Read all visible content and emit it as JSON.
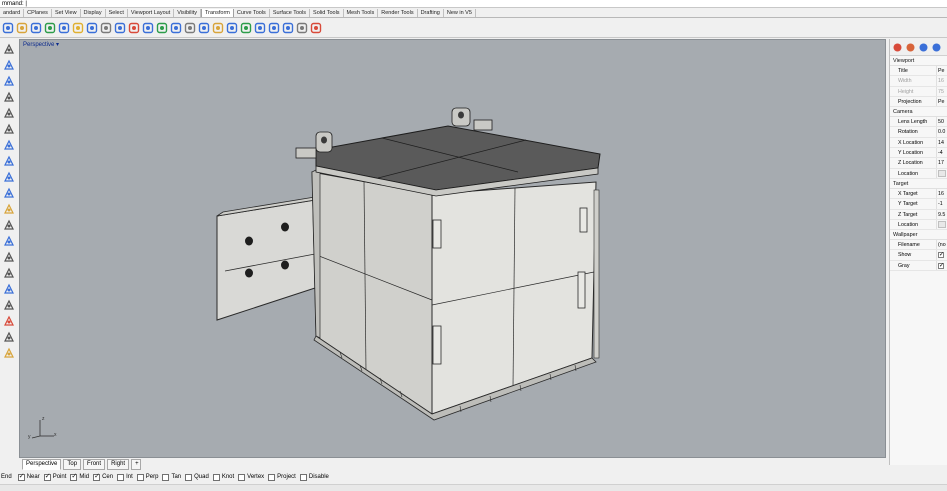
{
  "command_line": {
    "text": "mmand: |"
  },
  "toolbar_tabs": [
    {
      "label": "andard",
      "active": false
    },
    {
      "label": "CPlanes",
      "active": false
    },
    {
      "label": "Set View",
      "active": false
    },
    {
      "label": "Display",
      "active": false
    },
    {
      "label": "Select",
      "active": false
    },
    {
      "label": "Viewport Layout",
      "active": false
    },
    {
      "label": "Visibility",
      "active": false
    },
    {
      "label": "Transform",
      "active": true
    },
    {
      "label": "Curve Tools",
      "active": false
    },
    {
      "label": "Surface Tools",
      "active": false
    },
    {
      "label": "Solid Tools",
      "active": false
    },
    {
      "label": "Mesh Tools",
      "active": false
    },
    {
      "label": "Render Tools",
      "active": false
    },
    {
      "label": "Drafting",
      "active": false
    },
    {
      "label": "New in V5",
      "active": false
    }
  ],
  "toolbar_icons": [
    {
      "name": "move-icon",
      "color": "#3a6fd8"
    },
    {
      "name": "copy-icon",
      "color": "#d8a43a"
    },
    {
      "name": "rotate-icon",
      "color": "#3a6fd8"
    },
    {
      "name": "scale-icon",
      "color": "#2c9c4a"
    },
    {
      "name": "mirror-icon",
      "color": "#3a6fd8"
    },
    {
      "name": "orient-icon",
      "color": "#e0b030"
    },
    {
      "name": "array-icon",
      "color": "#3a6fd8"
    },
    {
      "name": "array-polar-icon",
      "color": "#7a7a7a"
    },
    {
      "name": "bend-icon",
      "color": "#3a6fd8"
    },
    {
      "name": "twist-icon",
      "color": "#d84a3a"
    },
    {
      "name": "taper-icon",
      "color": "#3a6fd8"
    },
    {
      "name": "flow-icon",
      "color": "#2c9c4a"
    },
    {
      "name": "smash-icon",
      "color": "#3a6fd8"
    },
    {
      "name": "cage-edit-icon",
      "color": "#7a7a7a"
    },
    {
      "name": "align-icon",
      "color": "#3a6fd8"
    },
    {
      "name": "set-points-icon",
      "color": "#d8a43a"
    },
    {
      "name": "project-icon",
      "color": "#3a6fd8"
    },
    {
      "name": "splop-icon",
      "color": "#2c9c4a"
    },
    {
      "name": "stretch-icon",
      "color": "#3a6fd8"
    },
    {
      "name": "shear-icon",
      "color": "#3a6fd8"
    },
    {
      "name": "maelstrom-icon",
      "color": "#3a6fd8"
    },
    {
      "name": "soft-move-icon",
      "color": "#7a7a7a"
    },
    {
      "name": "gumball-icon",
      "color": "#d84a3a"
    }
  ],
  "sidebar_icons": [
    {
      "name": "select-icon",
      "color": "#555"
    },
    {
      "name": "point-icon",
      "color": "#3a6fd8"
    },
    {
      "name": "polyline-icon",
      "color": "#3a6fd8"
    },
    {
      "name": "circle-icon",
      "color": "#555"
    },
    {
      "name": "rectangle-icon",
      "color": "#555"
    },
    {
      "name": "curve-icon",
      "color": "#555"
    },
    {
      "name": "fillet-icon",
      "color": "#3a6fd8"
    },
    {
      "name": "surface-icon",
      "color": "#3a6fd8"
    },
    {
      "name": "solid-icon",
      "color": "#3a6fd8"
    },
    {
      "name": "mesh-icon",
      "color": "#3a6fd8"
    },
    {
      "name": "dimension-icon",
      "color": "#d8a43a"
    },
    {
      "name": "transform-icon",
      "color": "#555"
    },
    {
      "name": "array-tool-icon",
      "color": "#3a6fd8"
    },
    {
      "name": "boolean-icon",
      "color": "#555"
    },
    {
      "name": "analyze-icon",
      "color": "#555"
    },
    {
      "name": "render-icon",
      "color": "#3a6fd8"
    },
    {
      "name": "gear-icon",
      "color": "#555"
    },
    {
      "name": "layer-icon",
      "color": "#d84a3a"
    },
    {
      "name": "check-icon",
      "color": "#555"
    },
    {
      "name": "paint-icon",
      "color": "#d8a43a"
    }
  ],
  "viewport": {
    "title": "Perspective",
    "dropdown_glyph": "▾",
    "background": "#a6abb0",
    "axis_x": "x",
    "axis_y": "y",
    "axis_z": "z"
  },
  "viewport_tabs": [
    {
      "label": "Perspective",
      "active": true
    },
    {
      "label": "Top",
      "active": false
    },
    {
      "label": "Front",
      "active": false
    },
    {
      "label": "Right",
      "active": false
    }
  ],
  "viewport_tab_add": "+",
  "osnaps": [
    {
      "label": "End",
      "checked": true
    },
    {
      "label": "Near",
      "checked": true
    },
    {
      "label": "Point",
      "checked": true
    },
    {
      "label": "Mid",
      "checked": true
    },
    {
      "label": "Cen",
      "checked": true
    },
    {
      "label": "Int",
      "checked": false
    },
    {
      "label": "Perp",
      "checked": false
    },
    {
      "label": "Tan",
      "checked": false
    },
    {
      "label": "Quad",
      "checked": false
    },
    {
      "label": "Knot",
      "checked": false
    },
    {
      "label": "Vertex",
      "checked": false
    },
    {
      "label": "Project",
      "checked": false
    },
    {
      "label": "Disable",
      "checked": false
    }
  ],
  "panel": {
    "icons": [
      {
        "name": "properties-icon",
        "color": "#d84a3a"
      },
      {
        "name": "material-icon",
        "color": "#d8643a"
      },
      {
        "name": "display-icon",
        "color": "#3a6fd8"
      },
      {
        "name": "layers-icon",
        "color": "#3a6fd8"
      }
    ],
    "sections": [
      {
        "title": "Viewport",
        "rows": [
          {
            "label": "Title",
            "value": "Pe",
            "type": "text",
            "disabled": false
          },
          {
            "label": "Width",
            "value": "16",
            "type": "text",
            "disabled": true
          },
          {
            "label": "Height",
            "value": "75",
            "type": "text",
            "disabled": true
          },
          {
            "label": "Projection",
            "value": "Pe",
            "type": "text",
            "disabled": false
          }
        ]
      },
      {
        "title": "Camera",
        "rows": [
          {
            "label": "Lens Length",
            "value": "50",
            "type": "text",
            "disabled": false
          },
          {
            "label": "Rotation",
            "value": "0.0",
            "type": "text",
            "disabled": false
          },
          {
            "label": "X Location",
            "value": "14",
            "type": "text",
            "disabled": false
          },
          {
            "label": "Y Location",
            "value": "-4",
            "type": "text",
            "disabled": false
          },
          {
            "label": "Z Location",
            "value": "17",
            "type": "text",
            "disabled": false
          },
          {
            "label": "Location",
            "value": "",
            "type": "button",
            "disabled": false
          }
        ]
      },
      {
        "title": "Target",
        "rows": [
          {
            "label": "X Target",
            "value": "16",
            "type": "text",
            "disabled": false
          },
          {
            "label": "Y Target",
            "value": "-1",
            "type": "text",
            "disabled": false
          },
          {
            "label": "Z Target",
            "value": "9.5",
            "type": "text",
            "disabled": false
          },
          {
            "label": "Location",
            "value": "",
            "type": "button",
            "disabled": false
          }
        ]
      },
      {
        "title": "Wallpaper",
        "rows": [
          {
            "label": "Filename",
            "value": "(no",
            "type": "text",
            "disabled": false
          },
          {
            "label": "Show",
            "value": "",
            "type": "checkbox",
            "disabled": false
          },
          {
            "label": "Gray",
            "value": "",
            "type": "checkbox",
            "disabled": false
          }
        ]
      }
    ]
  }
}
